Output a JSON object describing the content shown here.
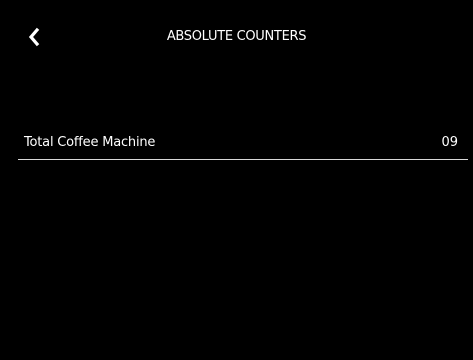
{
  "header": {
    "title": "ABSOLUTE COUNTERS",
    "back_icon": "chevron-left-icon"
  },
  "counters": [
    {
      "label": "Total Coffee Machine",
      "value": "09"
    }
  ],
  "colors": {
    "background": "#000000",
    "text": "#ffffff",
    "divider": "#d8d8d8"
  }
}
